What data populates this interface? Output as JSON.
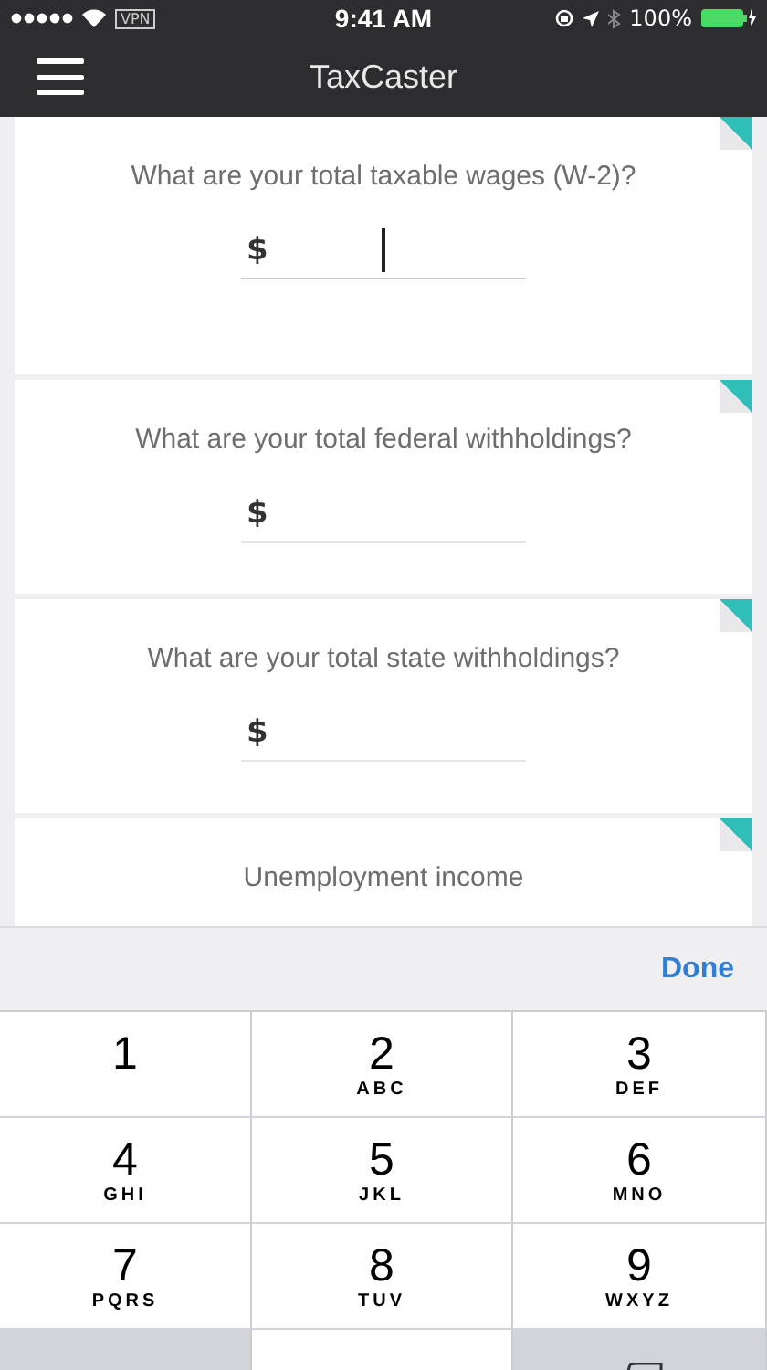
{
  "status_bar": {
    "carrier_vpn": "VPN",
    "time": "9:41 AM",
    "battery": "100%"
  },
  "nav_bar": {
    "title": "TaxCaster"
  },
  "questions": [
    {
      "prompt": "What are your total taxable wages (W-2)?",
      "currency": "$",
      "focused": true
    },
    {
      "prompt": "What are your total federal withholdings?",
      "currency": "$",
      "focused": false
    },
    {
      "prompt": "What are your total state withholdings?",
      "currency": "$",
      "focused": false
    },
    {
      "prompt": "Unemployment income"
    }
  ],
  "keyboard_toolbar": {
    "done": "Done"
  },
  "keypad": [
    {
      "digit": "1"
    },
    {
      "digit": "2",
      "letters": "ABC"
    },
    {
      "digit": "3",
      "letters": "DEF"
    },
    {
      "digit": "4",
      "letters": "GHI"
    },
    {
      "digit": "5",
      "letters": "JKL"
    },
    {
      "digit": "6",
      "letters": "MNO"
    },
    {
      "digit": "7",
      "letters": "PQRS"
    },
    {
      "digit": "8",
      "letters": "TUV"
    },
    {
      "digit": "9",
      "letters": "WXYZ"
    }
  ]
}
